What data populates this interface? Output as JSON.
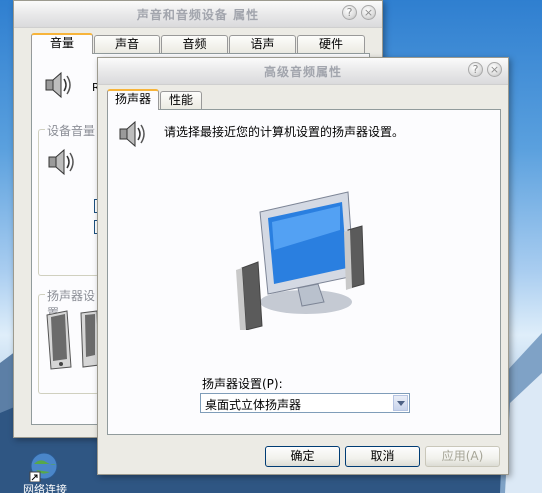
{
  "back_window": {
    "title": "声音和音频设备 属性",
    "tabs": [
      "音量",
      "声音",
      "音频",
      "语声",
      "硬件"
    ],
    "active_tab": "音量",
    "mixer_letter": "R",
    "group_device_volume": "设备音量",
    "group_speaker_settings": "扬声器设置"
  },
  "front_window": {
    "title": "高级音频属性",
    "tabs": [
      "扬声器",
      "性能"
    ],
    "active_tab": "扬声器",
    "description": "请选择最接近您的计算机设置的扬声器设置。",
    "speaker_setup_label": "扬声器设置(P):",
    "speaker_setup_value": "桌面式立体扬声器",
    "buttons": {
      "ok": "确定",
      "cancel": "取消",
      "apply": "应用(A)"
    }
  },
  "taskbar_icon": {
    "label": "网络连接"
  },
  "icons": [
    "speaker-icon",
    "monitor-speakers-illustration",
    "minimize-icon",
    "close-icon",
    "dropdown-arrow-icon"
  ]
}
